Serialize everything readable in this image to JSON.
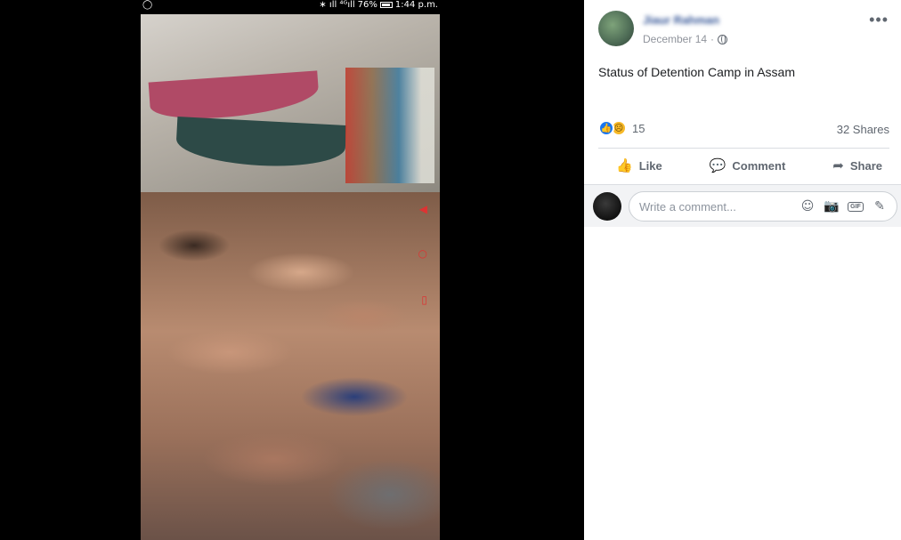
{
  "phone_status": {
    "left_icon": "◯",
    "signal": "∗ ıll ⁴ᴳıll",
    "battery": "76%",
    "time": "1:44 p.m."
  },
  "photo": {
    "icons": [
      "heart-outline-icon",
      "circle-record-icon",
      "square-icon"
    ]
  },
  "post": {
    "author": "Jiaur Rahman",
    "date": "December 14",
    "separator": "·",
    "privacy": "public-globe-icon",
    "more": "•••",
    "text": "Status of Detention Camp in Assam",
    "reaction_count": "15",
    "shares": "32 Shares",
    "actions": {
      "like": "Like",
      "comment": "Comment",
      "share": "Share"
    },
    "comment_placeholder": "Write a comment...",
    "gif_label": "GIF"
  },
  "colors": {
    "author_link": "#385898",
    "like_blue": "#1877f2",
    "sad_yellow": "#f7b928",
    "muted_text": "#606770",
    "comment_bg": "#f2f3f5"
  }
}
